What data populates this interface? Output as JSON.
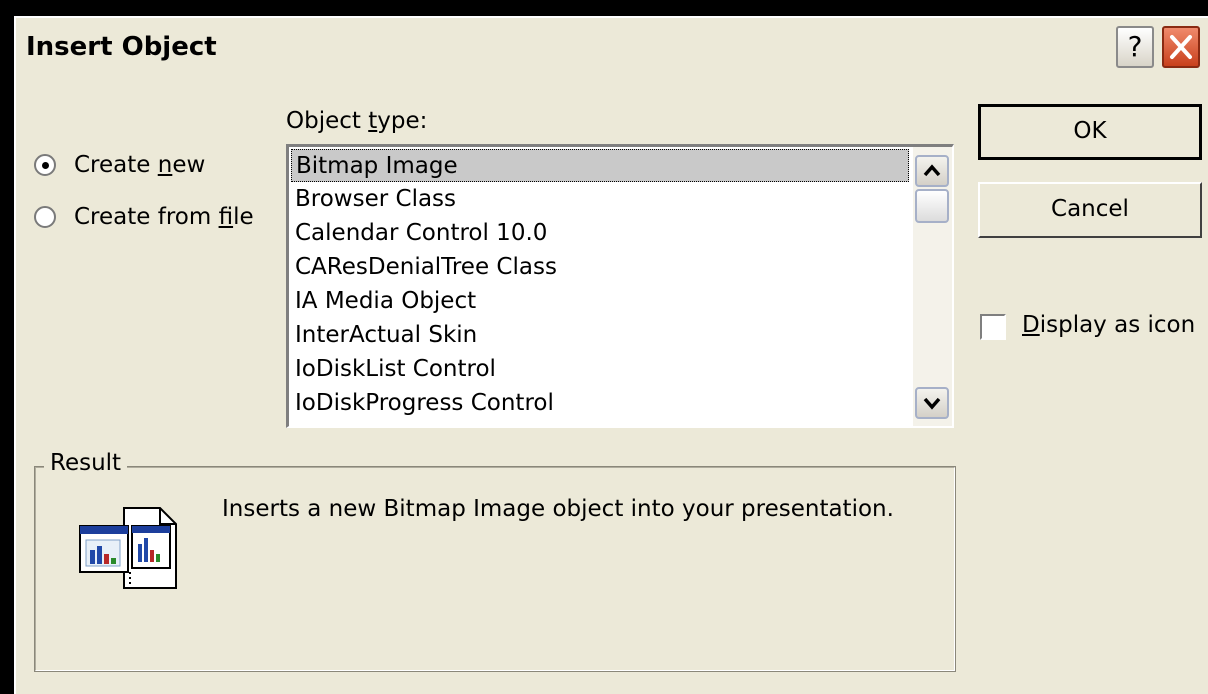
{
  "window": {
    "title": "Insert Object",
    "help_label": "?"
  },
  "options": {
    "create_new": {
      "pre": "Create ",
      "accel": "n",
      "post": "ew",
      "selected": true
    },
    "create_from_file": {
      "pre": "Create from ",
      "accel": "f",
      "post": "ile",
      "selected": false
    }
  },
  "object_type": {
    "label_pre": "Object ",
    "label_accel": "t",
    "label_post": "ype:",
    "items": [
      "Bitmap Image",
      "Browser Class",
      "Calendar Control 10.0",
      "CAResDenialTree Class",
      "IA Media Object",
      "InterActual Skin",
      "IoDiskList Control",
      "IoDiskProgress Control"
    ],
    "selected_index": 0
  },
  "buttons": {
    "ok": "OK",
    "cancel": "Cancel"
  },
  "display_as_icon": {
    "accel": "D",
    "post": "isplay as icon",
    "checked": false
  },
  "result": {
    "legend": "Result",
    "text": "Inserts a new Bitmap Image object into your presentation."
  },
  "colors": {
    "dialog_bg": "#ece9d8",
    "selection_bg": "#c9c9c9",
    "close_button": "#c8401c"
  },
  "icons": {
    "help": "help-icon",
    "close": "close-icon",
    "scroll_up": "chevron-up-icon",
    "scroll_down": "chevron-down-icon",
    "result": "bitmap-object-icon"
  }
}
